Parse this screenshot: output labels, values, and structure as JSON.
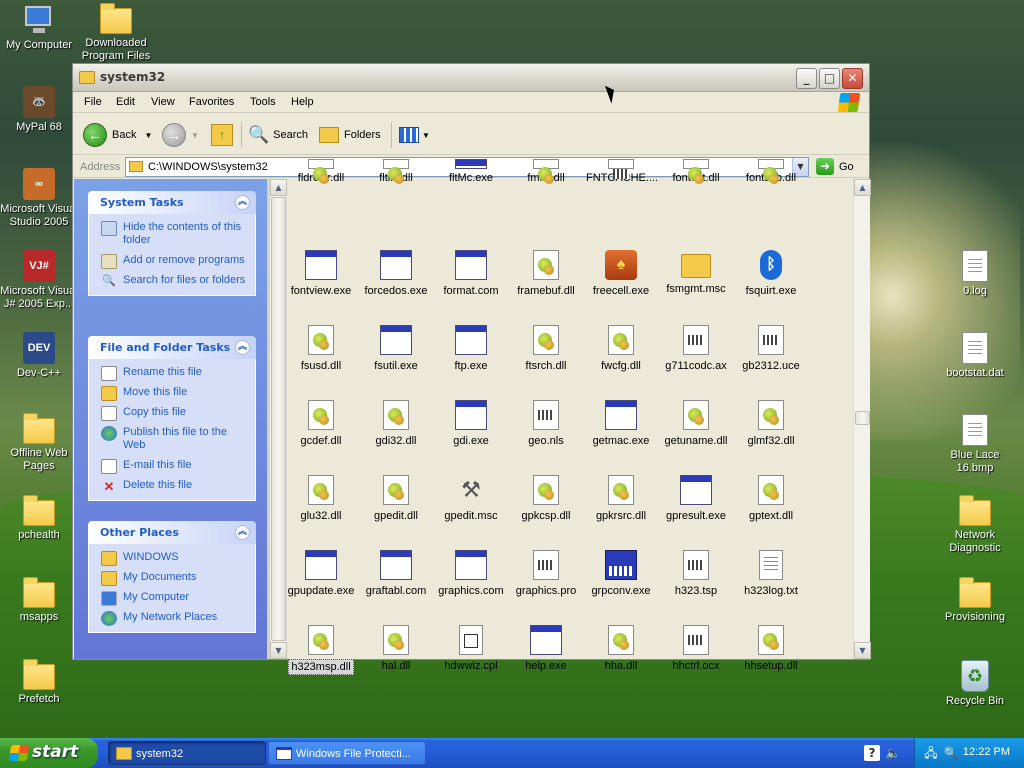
{
  "desktop": {
    "icons": [
      {
        "label": "My Computer"
      },
      {
        "label": "Downloaded Program Files"
      },
      {
        "label": "MyPal 68"
      },
      {
        "label": "Microsoft Visual Studio 2005"
      },
      {
        "label": "Microsoft Visual J# 2005 Exp..."
      },
      {
        "label": "Dev-C++"
      },
      {
        "label": "Offline Web Pages"
      },
      {
        "label": "pchealth"
      },
      {
        "label": "msapps"
      },
      {
        "label": "Prefetch"
      },
      {
        "label": "0.log"
      },
      {
        "label": "bootstat.dat"
      },
      {
        "label": "Blue Lace 16.bmp"
      },
      {
        "label": "Network Diagnostic"
      },
      {
        "label": "Provisioning"
      },
      {
        "label": "Recycle Bin"
      }
    ]
  },
  "window": {
    "title": "system32",
    "controls": {
      "minimize": "_",
      "maximize": "□",
      "close": "✕"
    },
    "menu": [
      "File",
      "Edit",
      "View",
      "Favorites",
      "Tools",
      "Help"
    ],
    "toolbar": {
      "back": "Back",
      "search": "Search",
      "folders": "Folders"
    },
    "address": {
      "label": "Address",
      "value": "C:\\WINDOWS\\system32",
      "go": "Go"
    }
  },
  "left_pane": {
    "system_tasks": {
      "title": "System Tasks",
      "items": [
        "Hide the contents of this folder",
        "Add or remove programs",
        "Search for files or folders"
      ]
    },
    "file_folder_tasks": {
      "title": "File and Folder Tasks",
      "items": [
        "Rename this file",
        "Move this file",
        "Copy this file",
        "Publish this file to the Web",
        "E-mail this file",
        "Delete this file"
      ]
    },
    "other_places": {
      "title": "Other Places",
      "items": [
        "WINDOWS",
        "My Documents",
        "My Computer",
        "My Network Places"
      ]
    }
  },
  "files": {
    "row0": [
      "fldrclnr.dll",
      "fltlib.dll",
      "fltMc.exe",
      "fmifs.dll",
      "FNTCACHE....",
      "fontext.dll",
      "fontsub.dll"
    ],
    "row1": [
      "fontview.exe",
      "forcedos.exe",
      "format.com",
      "framebuf.dll",
      "freecell.exe",
      "fsmgmt.msc",
      "fsquirt.exe"
    ],
    "row2": [
      "fsusd.dll",
      "fsutil.exe",
      "ftp.exe",
      "ftsrch.dll",
      "fwcfg.dll",
      "g711codc.ax",
      "gb2312.uce"
    ],
    "row3": [
      "gcdef.dll",
      "gdi32.dll",
      "gdi.exe",
      "geo.nls",
      "getmac.exe",
      "getuname.dll",
      "glmf32.dll"
    ],
    "row4": [
      "glu32.dll",
      "gpedit.dll",
      "gpedit.msc",
      "gpkcsp.dll",
      "gpkrsrc.dll",
      "gpresult.exe",
      "gptext.dll"
    ],
    "row5": [
      "gpupdate.exe",
      "graftabl.com",
      "graphics.com",
      "graphics.pro",
      "grpconv.exe",
      "h323.tsp",
      "h323log.txt"
    ],
    "row6": [
      "h323msp.dll",
      "hal.dll",
      "hdwwiz.cpl",
      "help.exe",
      "hha.dll",
      "hhctrl.ocx",
      "hhsetup.dll"
    ],
    "selected": "h323msp.dll"
  },
  "taskbar": {
    "start": "start",
    "tasks": [
      {
        "label": "system32",
        "active": true
      },
      {
        "label": "Windows File Protecti...",
        "active": false
      }
    ],
    "clock": "12:22 PM"
  }
}
